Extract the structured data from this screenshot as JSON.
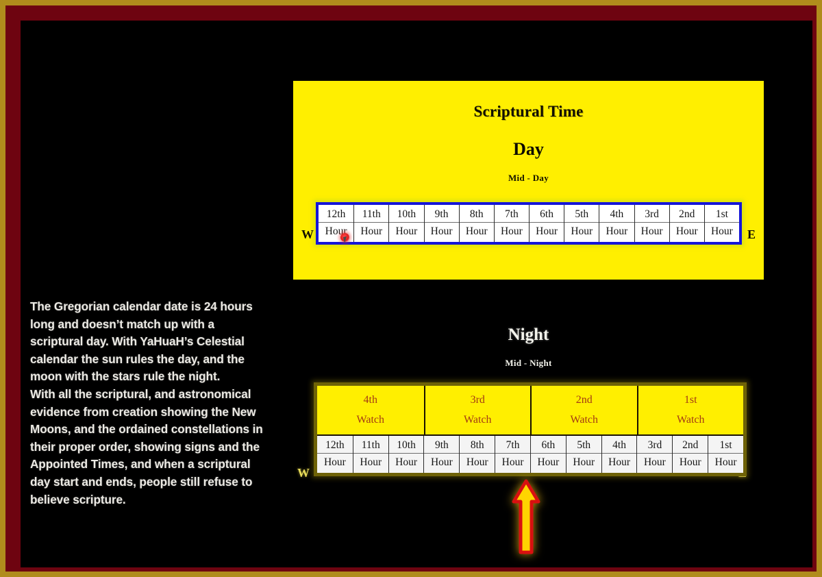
{
  "frame": {
    "outer_border_color": "#b08c1c",
    "inner_border_color": "#6e0410",
    "canvas_color": "#000000"
  },
  "body_text": "The Gregorian calendar date is 24 hours long and doesn’t match up with a scriptural day. With YaHuaH’s Celestial calendar the sun rules the day, and the moon with the stars rule the night.\nWith all the scriptural, and astronomical evidence from creation showing the New Moons, and the ordained constellations in their proper order, showing signs and the Appointed Times, and when a scriptural day start and ends, people still refuse to believe scripture.",
  "day": {
    "panel_color": "#ffef00",
    "title": "Scriptural Time",
    "subtitle": "Day",
    "midpoint_label": "Mid - Day",
    "west_label": "W",
    "east_label": "E",
    "grid_border_color": "#1515d8",
    "hours": [
      {
        "ordinal": "12th",
        "unit": "Hour"
      },
      {
        "ordinal": "11th",
        "unit": "Hour"
      },
      {
        "ordinal": "10th",
        "unit": "Hour"
      },
      {
        "ordinal": "9th",
        "unit": "Hour"
      },
      {
        "ordinal": "8th",
        "unit": "Hour"
      },
      {
        "ordinal": "7th",
        "unit": "Hour"
      },
      {
        "ordinal": "6th",
        "unit": "Hour"
      },
      {
        "ordinal": "5th",
        "unit": "Hour"
      },
      {
        "ordinal": "4th",
        "unit": "Hour"
      },
      {
        "ordinal": "3rd",
        "unit": "Hour"
      },
      {
        "ordinal": "2nd",
        "unit": "Hour"
      },
      {
        "ordinal": "1st",
        "unit": "Hour"
      }
    ]
  },
  "night": {
    "title": "Night",
    "midpoint_label": "Mid - Night",
    "west_label": "W",
    "east_label": "E",
    "watch_text_color": "#a33a14",
    "panel_color": "#ffef00",
    "watches": [
      {
        "ordinal": "4th",
        "label": "Watch"
      },
      {
        "ordinal": "3rd",
        "label": "Watch"
      },
      {
        "ordinal": "2nd",
        "label": "Watch"
      },
      {
        "ordinal": "1st",
        "label": "Watch"
      }
    ],
    "hours": [
      {
        "ordinal": "12th",
        "unit": "Hour"
      },
      {
        "ordinal": "11th",
        "unit": "Hour"
      },
      {
        "ordinal": "10th",
        "unit": "Hour"
      },
      {
        "ordinal": "9th",
        "unit": "Hour"
      },
      {
        "ordinal": "8th",
        "unit": "Hour"
      },
      {
        "ordinal": "7th",
        "unit": "Hour"
      },
      {
        "ordinal": "6th",
        "unit": "Hour"
      },
      {
        "ordinal": "5th",
        "unit": "Hour"
      },
      {
        "ordinal": "4th",
        "unit": "Hour"
      },
      {
        "ordinal": "3rd",
        "unit": "Hour"
      },
      {
        "ordinal": "2nd",
        "unit": "Hour"
      },
      {
        "ordinal": "1st",
        "unit": "Hour"
      }
    ],
    "arrow": {
      "icon": "up-arrow-icon",
      "outline_color": "#d81010",
      "fill_color": "#ffd400"
    }
  },
  "cursor": {
    "icon": "click-marker-icon",
    "color": "#e01b1b"
  }
}
